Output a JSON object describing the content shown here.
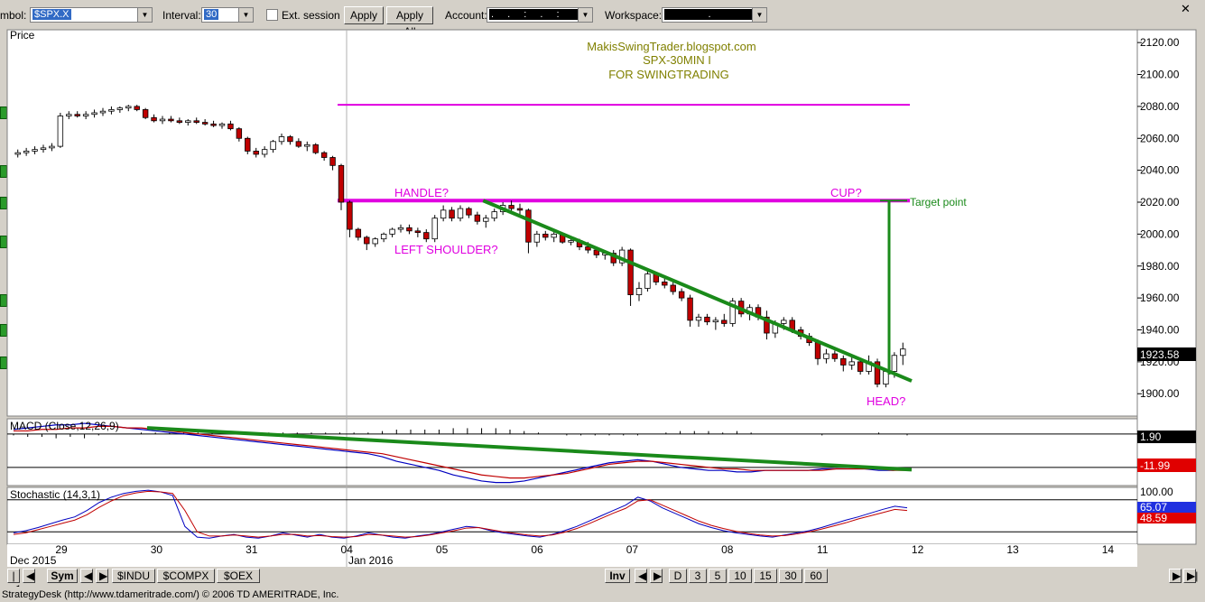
{
  "toolbar": {
    "symbol_label": "mbol:",
    "symbol_value": "$SPX.X",
    "interval_label": "Interval:",
    "interval_value": "30",
    "ext_session_label": "Ext. session",
    "apply_label": "Apply",
    "apply_all_label": "Apply All",
    "account_label": "Account:",
    "account_value": ". . : . :",
    "workspace_label": "Workspace:",
    "workspace_value": "."
  },
  "annotations": {
    "blog": "MakisSwingTrader.blogspot.com",
    "symbol_tf": "SPX-30MIN  I",
    "purpose": "FOR SWINGTRADING",
    "handle": "HANDLE?",
    "cup": "CUP?",
    "target": "Target point",
    "left_shoulder": "LEFT SHOULDER?",
    "head": "HEAD?"
  },
  "colors": {
    "up_candle": "#ffffff",
    "down_candle": "#c00000",
    "magenta": "#e000e0",
    "trendline": "#1a8a1a",
    "annotation_text": "#808000",
    "macd_line": "#0000c0",
    "signal_line": "#c00000"
  },
  "bottom_bar": {
    "sym_label": "Sym",
    "symbols": [
      "$INDU",
      "$COMPX",
      "$OEX"
    ],
    "inv_label": "Inv",
    "intervals": [
      "D",
      "3",
      "5",
      "10",
      "15",
      "30",
      "60"
    ]
  },
  "status_text": "StrategyDesk (http://www.tdameritrade.com/) © 2006 TD AMERITRADE, Inc.",
  "chart_data": [
    {
      "type": "candlestick",
      "title": "Price",
      "last_price": "1923.58",
      "ylim": [
        1886,
        2128
      ],
      "yticks": [
        "2120.00",
        "2100.00",
        "2080.00",
        "2060.00",
        "2040.00",
        "2020.00",
        "2000.00",
        "1980.00",
        "1960.00",
        "1940.00",
        "1920.00",
        "1900.00"
      ],
      "x_tick_labels": [
        "29",
        "30",
        "31",
        "04",
        "05",
        "06",
        "07",
        "08",
        "11",
        "12",
        "13",
        "14"
      ],
      "x_sub_labels": [
        "Dec 2015",
        "Jan 2016"
      ],
      "horizontal_lines": [
        2081,
        2021
      ],
      "trendline": {
        "from": {
          "bar": 55,
          "price": 2021
        },
        "to": {
          "bar": 101,
          "price": 1908
        }
      },
      "target_line": {
        "bar": 96,
        "from": 1912,
        "to": 2021
      },
      "ohlc": [
        [
          2050,
          2053,
          2048,
          2051
        ],
        [
          2051,
          2054,
          2049,
          2052
        ],
        [
          2052,
          2055,
          2050,
          2053
        ],
        [
          2053,
          2056,
          2051,
          2054
        ],
        [
          2054,
          2057,
          2052,
          2055
        ],
        [
          2055,
          2076,
          2054,
          2074
        ],
        [
          2074,
          2077,
          2072,
          2075
        ],
        [
          2075,
          2077,
          2073,
          2074
        ],
        [
          2074,
          2077,
          2072,
          2075
        ],
        [
          2075,
          2078,
          2073,
          2076
        ],
        [
          2076,
          2079,
          2074,
          2077
        ],
        [
          2077,
          2080,
          2075,
          2078
        ],
        [
          2078,
          2080,
          2076,
          2079
        ],
        [
          2079,
          2081,
          2077,
          2080
        ],
        [
          2080,
          2081,
          2077,
          2078
        ],
        [
          2078,
          2079,
          2072,
          2073
        ],
        [
          2073,
          2075,
          2070,
          2071
        ],
        [
          2071,
          2074,
          2069,
          2072
        ],
        [
          2072,
          2074,
          2070,
          2071
        ],
        [
          2071,
          2073,
          2069,
          2070
        ],
        [
          2070,
          2072,
          2068,
          2071
        ],
        [
          2071,
          2073,
          2069,
          2070
        ],
        [
          2070,
          2072,
          2068,
          2069
        ],
        [
          2069,
          2071,
          2067,
          2068
        ],
        [
          2068,
          2070,
          2066,
          2069
        ],
        [
          2069,
          2071,
          2065,
          2066
        ],
        [
          2066,
          2067,
          2058,
          2060
        ],
        [
          2060,
          2061,
          2050,
          2052
        ],
        [
          2052,
          2054,
          2048,
          2050
        ],
        [
          2050,
          2055,
          2048,
          2053
        ],
        [
          2053,
          2059,
          2051,
          2058
        ],
        [
          2058,
          2063,
          2056,
          2061
        ],
        [
          2061,
          2062,
          2056,
          2058
        ],
        [
          2058,
          2060,
          2054,
          2055
        ],
        [
          2055,
          2058,
          2052,
          2056
        ],
        [
          2056,
          2057,
          2050,
          2051
        ],
        [
          2051,
          2052,
          2046,
          2048
        ],
        [
          2048,
          2049,
          2040,
          2043
        ],
        [
          2043,
          2044,
          2015,
          2020
        ],
        [
          2020,
          2021,
          1998,
          2003
        ],
        [
          2003,
          2004,
          1996,
          1998
        ],
        [
          1998,
          1999,
          1990,
          1994
        ],
        [
          1994,
          1998,
          1992,
          1997
        ],
        [
          1997,
          2001,
          1995,
          2000
        ],
        [
          2000,
          2004,
          1998,
          2003
        ],
        [
          2003,
          2006,
          2001,
          2004
        ],
        [
          2004,
          2006,
          2000,
          2002
        ],
        [
          2002,
          2004,
          1998,
          2001
        ],
        [
          2001,
          2003,
          1995,
          1997
        ],
        [
          1997,
          2012,
          1995,
          2010
        ],
        [
          2010,
          2018,
          2008,
          2015
        ],
        [
          2015,
          2017,
          2008,
          2010
        ],
        [
          2010,
          2018,
          2008,
          2016
        ],
        [
          2016,
          2017,
          2010,
          2012
        ],
        [
          2012,
          2014,
          2006,
          2008
        ],
        [
          2008,
          2012,
          2004,
          2010
        ],
        [
          2010,
          2016,
          2008,
          2014
        ],
        [
          2014,
          2020,
          2012,
          2018
        ],
        [
          2018,
          2021,
          2014,
          2016
        ],
        [
          2016,
          2019,
          2012,
          2015
        ],
        [
          2015,
          2016,
          1988,
          1995
        ],
        [
          1995,
          2002,
          1992,
          2000
        ],
        [
          2000,
          2002,
          1996,
          1998
        ],
        [
          1998,
          2002,
          1995,
          2000
        ],
        [
          2000,
          2001,
          1994,
          1995
        ],
        [
          1995,
          1998,
          1993,
          1996
        ],
        [
          1996,
          1997,
          1990,
          1992
        ],
        [
          1992,
          1995,
          1988,
          1990
        ],
        [
          1990,
          1992,
          1985,
          1987
        ],
        [
          1987,
          1990,
          1984,
          1988
        ],
        [
          1988,
          1990,
          1980,
          1982
        ],
        [
          1982,
          1992,
          1980,
          1990
        ],
        [
          1990,
          1991,
          1955,
          1962
        ],
        [
          1962,
          1970,
          1958,
          1966
        ],
        [
          1966,
          1978,
          1964,
          1975
        ],
        [
          1975,
          1976,
          1968,
          1970
        ],
        [
          1970,
          1972,
          1966,
          1968
        ],
        [
          1968,
          1970,
          1962,
          1964
        ],
        [
          1964,
          1966,
          1958,
          1960
        ],
        [
          1960,
          1962,
          1942,
          1946
        ],
        [
          1946,
          1950,
          1942,
          1948
        ],
        [
          1948,
          1950,
          1943,
          1945
        ],
        [
          1945,
          1948,
          1940,
          1946
        ],
        [
          1946,
          1950,
          1942,
          1944
        ],
        [
          1944,
          1960,
          1942,
          1958
        ],
        [
          1958,
          1960,
          1948,
          1950
        ],
        [
          1950,
          1956,
          1946,
          1954
        ],
        [
          1954,
          1956,
          1946,
          1948
        ],
        [
          1948,
          1952,
          1934,
          1938
        ],
        [
          1938,
          1946,
          1935,
          1944
        ],
        [
          1944,
          1948,
          1940,
          1946
        ],
        [
          1946,
          1948,
          1938,
          1940
        ],
        [
          1940,
          1942,
          1934,
          1936
        ],
        [
          1936,
          1938,
          1930,
          1932
        ],
        [
          1932,
          1934,
          1918,
          1922
        ],
        [
          1922,
          1928,
          1919,
          1925
        ],
        [
          1925,
          1927,
          1920,
          1922
        ],
        [
          1922,
          1924,
          1914,
          1918
        ],
        [
          1918,
          1924,
          1915,
          1920
        ],
        [
          1920,
          1922,
          1912,
          1914
        ],
        [
          1914,
          1924,
          1912,
          1920
        ],
        [
          1920,
          1922,
          1904,
          1906
        ],
        [
          1906,
          1916,
          1904,
          1914
        ],
        [
          1914,
          1926,
          1910,
          1924
        ],
        [
          1924,
          1932,
          1918,
          1928
        ]
      ]
    },
    {
      "type": "line",
      "title": "MACD (Close,12,26,9)",
      "values_shown": [
        "1.90",
        "-11.99"
      ],
      "ylim": [
        -22,
        22
      ],
      "series": [
        {
          "name": "MACD",
          "values": [
            15,
            16,
            17,
            18,
            18,
            19,
            18,
            17,
            16,
            15,
            14,
            13,
            12,
            11,
            10,
            9,
            8,
            7,
            6,
            5,
            4,
            3,
            2,
            1,
            0,
            -1,
            -3,
            -6,
            -8,
            -10,
            -12,
            -15,
            -17,
            -19,
            -20,
            -20,
            -19,
            -17,
            -15,
            -13,
            -11,
            -9,
            -7,
            -6,
            -5,
            -6,
            -8,
            -10,
            -11,
            -12,
            -12,
            -13,
            -13,
            -12,
            -12,
            -12,
            -12,
            -11,
            -11,
            -11,
            -11,
            -12,
            -12,
            -11
          ]
        },
        {
          "name": "Signal",
          "values": [
            14,
            14,
            15,
            15,
            16,
            16,
            17,
            17,
            16,
            16,
            15,
            14,
            13,
            12,
            11,
            10,
            9,
            8,
            7,
            6,
            5,
            4,
            3,
            2,
            1,
            0,
            -1,
            -3,
            -5,
            -7,
            -9,
            -11,
            -13,
            -15,
            -16,
            -17,
            -17,
            -16,
            -15,
            -14,
            -12,
            -10,
            -8,
            -7,
            -6,
            -6,
            -7,
            -8,
            -9,
            -10,
            -11,
            -11,
            -12,
            -12,
            -12,
            -12,
            -12,
            -12,
            -11,
            -11,
            -11,
            -11,
            -12,
            -12
          ]
        }
      ]
    },
    {
      "type": "line",
      "title": "Stochastic (14,3,1)",
      "values_shown": [
        "100.00",
        "65.07",
        "48.59"
      ],
      "ylim": [
        0,
        100
      ],
      "series": [
        {
          "name": "%K",
          "values": [
            18,
            22,
            28,
            35,
            42,
            48,
            60,
            75,
            85,
            92,
            96,
            98,
            95,
            88,
            30,
            10,
            8,
            12,
            15,
            10,
            8,
            12,
            18,
            14,
            10,
            15,
            10,
            8,
            12,
            18,
            14,
            10,
            8,
            12,
            15,
            20,
            25,
            30,
            28,
            22,
            18,
            15,
            12,
            10,
            15,
            22,
            30,
            40,
            50,
            60,
            70,
            85,
            78,
            65,
            55,
            45,
            35,
            28,
            22,
            18,
            15,
            12,
            10,
            14,
            18,
            22,
            28,
            35,
            42,
            48,
            55,
            62,
            68,
            65
          ]
        },
        {
          "name": "%D",
          "values": [
            15,
            18,
            24,
            30,
            36,
            42,
            52,
            66,
            78,
            88,
            93,
            96,
            95,
            92,
            60,
            20,
            12,
            12,
            14,
            12,
            10,
            12,
            15,
            15,
            12,
            13,
            11,
            10,
            11,
            15,
            14,
            12,
            10,
            11,
            14,
            18,
            22,
            27,
            28,
            24,
            20,
            17,
            14,
            12,
            14,
            19,
            26,
            35,
            45,
            55,
            64,
            78,
            80,
            70,
            60,
            50,
            40,
            32,
            26,
            21,
            17,
            14,
            12,
            13,
            16,
            20,
            25,
            31,
            37,
            44,
            50,
            56,
            62,
            60
          ]
        }
      ]
    }
  ]
}
